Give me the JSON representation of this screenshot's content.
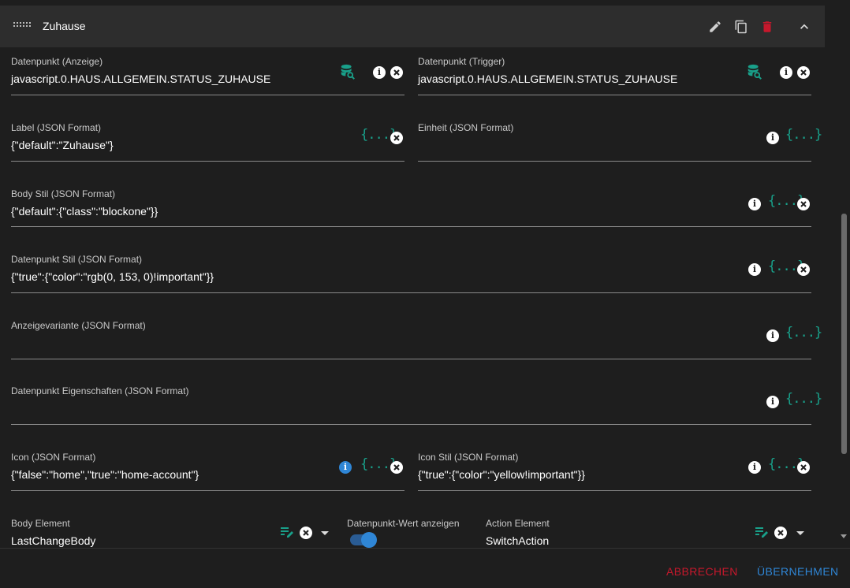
{
  "header": {
    "title": "Zuhause",
    "icons": [
      "drag-handle-icon",
      "pencil-icon",
      "copy-icon",
      "delete-icon",
      "chevron-up-icon"
    ]
  },
  "fields": {
    "dp_display": {
      "label": "Datenpunkt (Anzeige)",
      "value": "javascript.0.HAUS.ALLGEMEIN.STATUS_ZUHAUSE"
    },
    "dp_trigger": {
      "label": "Datenpunkt (Trigger)",
      "value": "javascript.0.HAUS.ALLGEMEIN.STATUS_ZUHAUSE"
    },
    "label": {
      "label": "Label (JSON Format)",
      "value": "{\"default\":\"Zuhause\"}"
    },
    "unit": {
      "label": "Einheit (JSON Format)",
      "value": ""
    },
    "body_style": {
      "label": "Body Stil (JSON Format)",
      "value": "{\"default\":{\"class\":\"blockone\"}}"
    },
    "dp_style": {
      "label": "Datenpunkt Stil (JSON Format)",
      "value": "{\"true\":{\"color\":\"rgb(0, 153, 0)!important\"}}"
    },
    "display_variant": {
      "label": "Anzeigevariante (JSON Format)",
      "value": ""
    },
    "dp_properties": {
      "label": "Datenpunkt Eigenschaften (JSON Format)",
      "value": ""
    },
    "icon": {
      "label": "Icon (JSON Format)",
      "value": "{\"false\":\"home\",\"true\":\"home-account\"}"
    },
    "icon_style": {
      "label": "Icon Stil (JSON Format)",
      "value": "{\"true\":{\"color\":\"yellow!important\"}}"
    },
    "body_element": {
      "label": "Body Element",
      "value": "LastChangeBody"
    },
    "show_value": {
      "label": "Datenpunkt-Wert anzeigen",
      "checked": true
    },
    "action_element": {
      "label": "Action Element",
      "value": "SwitchAction"
    }
  },
  "json_glyph": "{...}",
  "info_glyph": "i",
  "footer": {
    "cancel": "ABBRECHEN",
    "apply": "ÜBERNEHMEN"
  },
  "colors": {
    "accent": "#19a08a",
    "blue": "#2f86d6",
    "danger": "#c7182c",
    "background": "#1e1e1e",
    "header": "#2d2d2d"
  }
}
